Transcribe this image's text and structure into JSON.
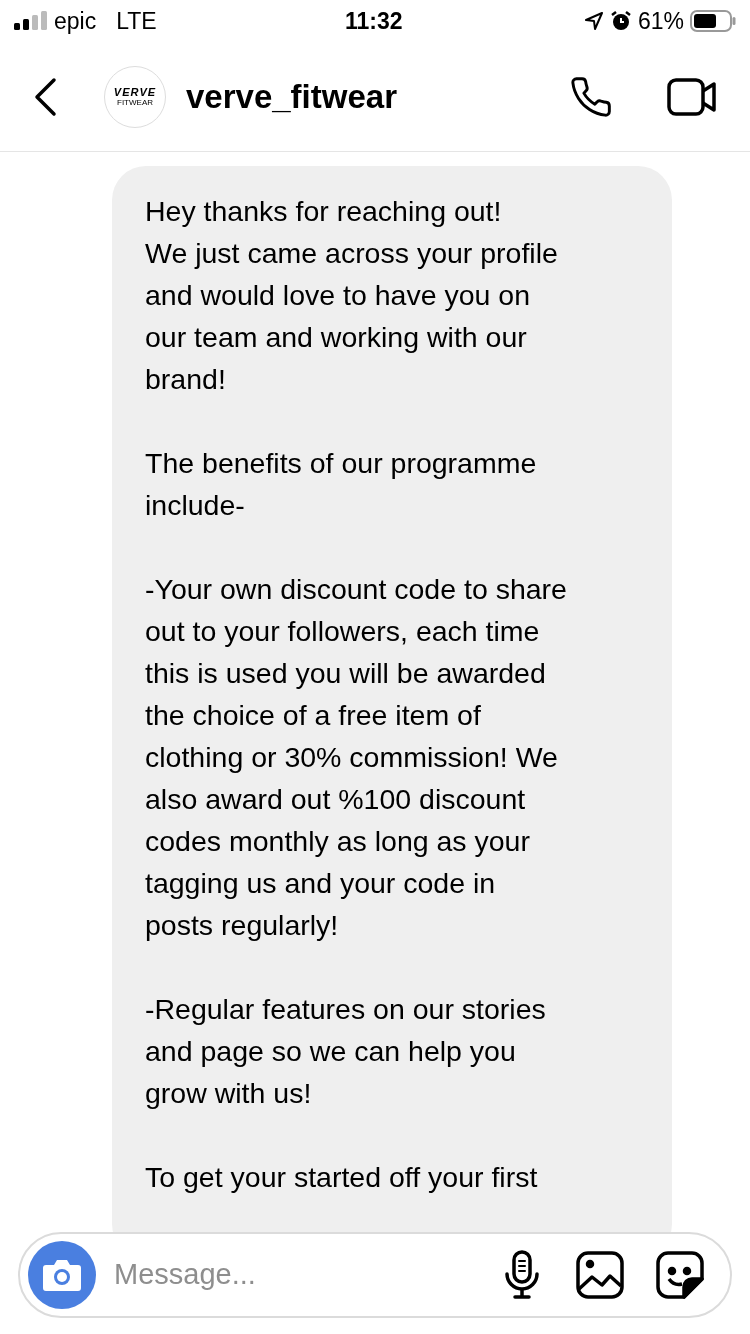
{
  "status_bar": {
    "carrier": "epic",
    "network": "LTE",
    "time": "11:32",
    "battery": "61%"
  },
  "header": {
    "username": "verve_fitwear",
    "avatar_logo": {
      "title": "VERVE",
      "subtitle": "FITWEAR"
    }
  },
  "messages": [
    {
      "kind": "received",
      "paragraphs": [
        [
          "Hey thanks for reaching out!",
          "We just came across your profile",
          "and would love to have you on",
          "our team and working with our",
          "brand!"
        ],
        [
          "The benefits of our programme",
          "include-"
        ],
        [
          "-Your own discount code to share",
          "out to your followers, each time",
          "this is used you will be awarded",
          "the choice of a free item of",
          "clothing or 30% commission! We",
          "also award out %100 discount",
          "codes monthly as long as your",
          "tagging us and your code in",
          "posts regularly!"
        ],
        [
          "-Regular features on our stories",
          "and page so we can help you",
          "grow with us!"
        ],
        [
          "To get your started off your first"
        ]
      ]
    }
  ],
  "composer": {
    "placeholder": "Message..."
  }
}
